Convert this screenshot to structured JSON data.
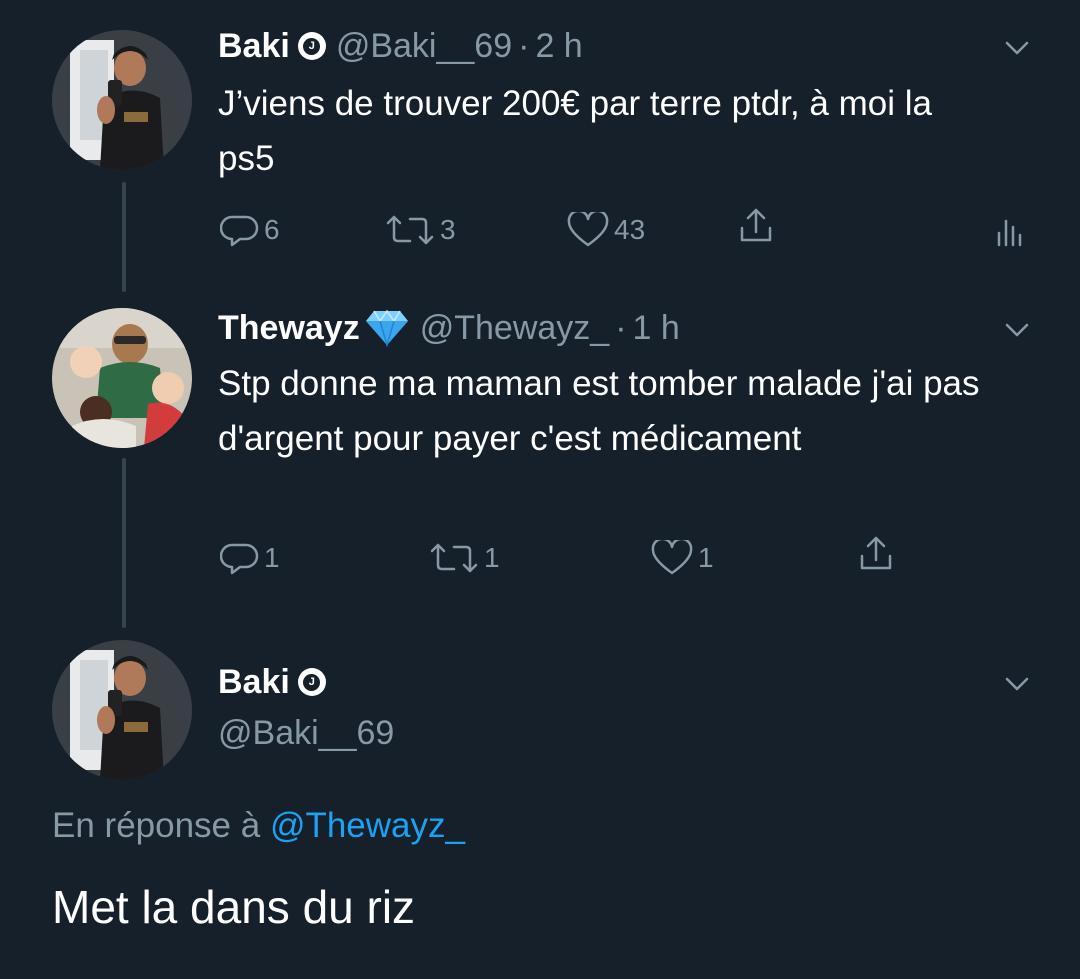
{
  "tweets": [
    {
      "name": "Baki",
      "handle": "@Baki__69",
      "separator": "·",
      "time": "2 h",
      "text": "J’viens de trouver 200€ par terre ptdr, à moi la ps5",
      "replies": "6",
      "retweets": "3",
      "likes": "43"
    },
    {
      "name": "Thewayz",
      "handle": "@Thewayz_",
      "separator": "·",
      "time": "1 h",
      "text": "Stp donne ma maman est tomber malade j'ai pas d'argent pour payer c'est médicament",
      "replies": "1",
      "retweets": "1",
      "likes": "1"
    }
  ],
  "focused": {
    "name": "Baki",
    "handle": "@Baki__69",
    "reply_prefix": "En réponse à ",
    "reply_to": "@Thewayz_",
    "text": "Met la dans du riz"
  },
  "icons": {
    "reply": "reply-icon",
    "retweet": "retweet-icon",
    "like": "heart-icon",
    "share": "share-icon",
    "analytics": "analytics-icon",
    "more": "chevron-down-icon",
    "verified": "verified-badge-icon",
    "diamond": "diamond-emoji-icon"
  },
  "colors": {
    "background": "#15202b",
    "secondary_text": "#8899a6",
    "link": "#1da1f2",
    "thread_line": "#38444d"
  }
}
